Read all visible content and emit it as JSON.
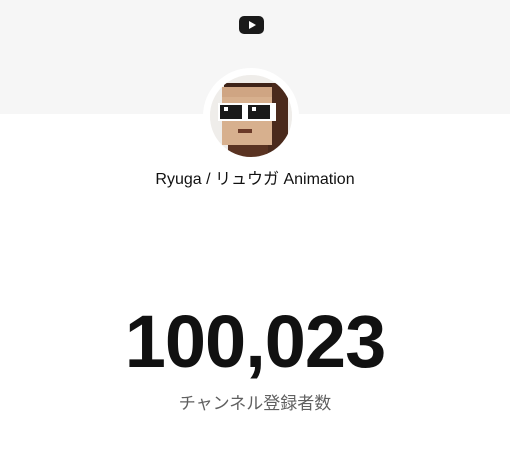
{
  "channel": {
    "name": "Ryuga / リュウガ Animation",
    "avatar_icon": "minecraft-character-avatar"
  },
  "header": {
    "logo_icon": "youtube-logo-icon",
    "logo_color": "#1a1a1a"
  },
  "stats": {
    "subscriber_count": "100,023",
    "subscriber_label": "チャンネル登録者数"
  },
  "colors": {
    "banner_bg": "#f6f6f6",
    "text_primary": "#111111",
    "text_secondary": "#606060"
  }
}
